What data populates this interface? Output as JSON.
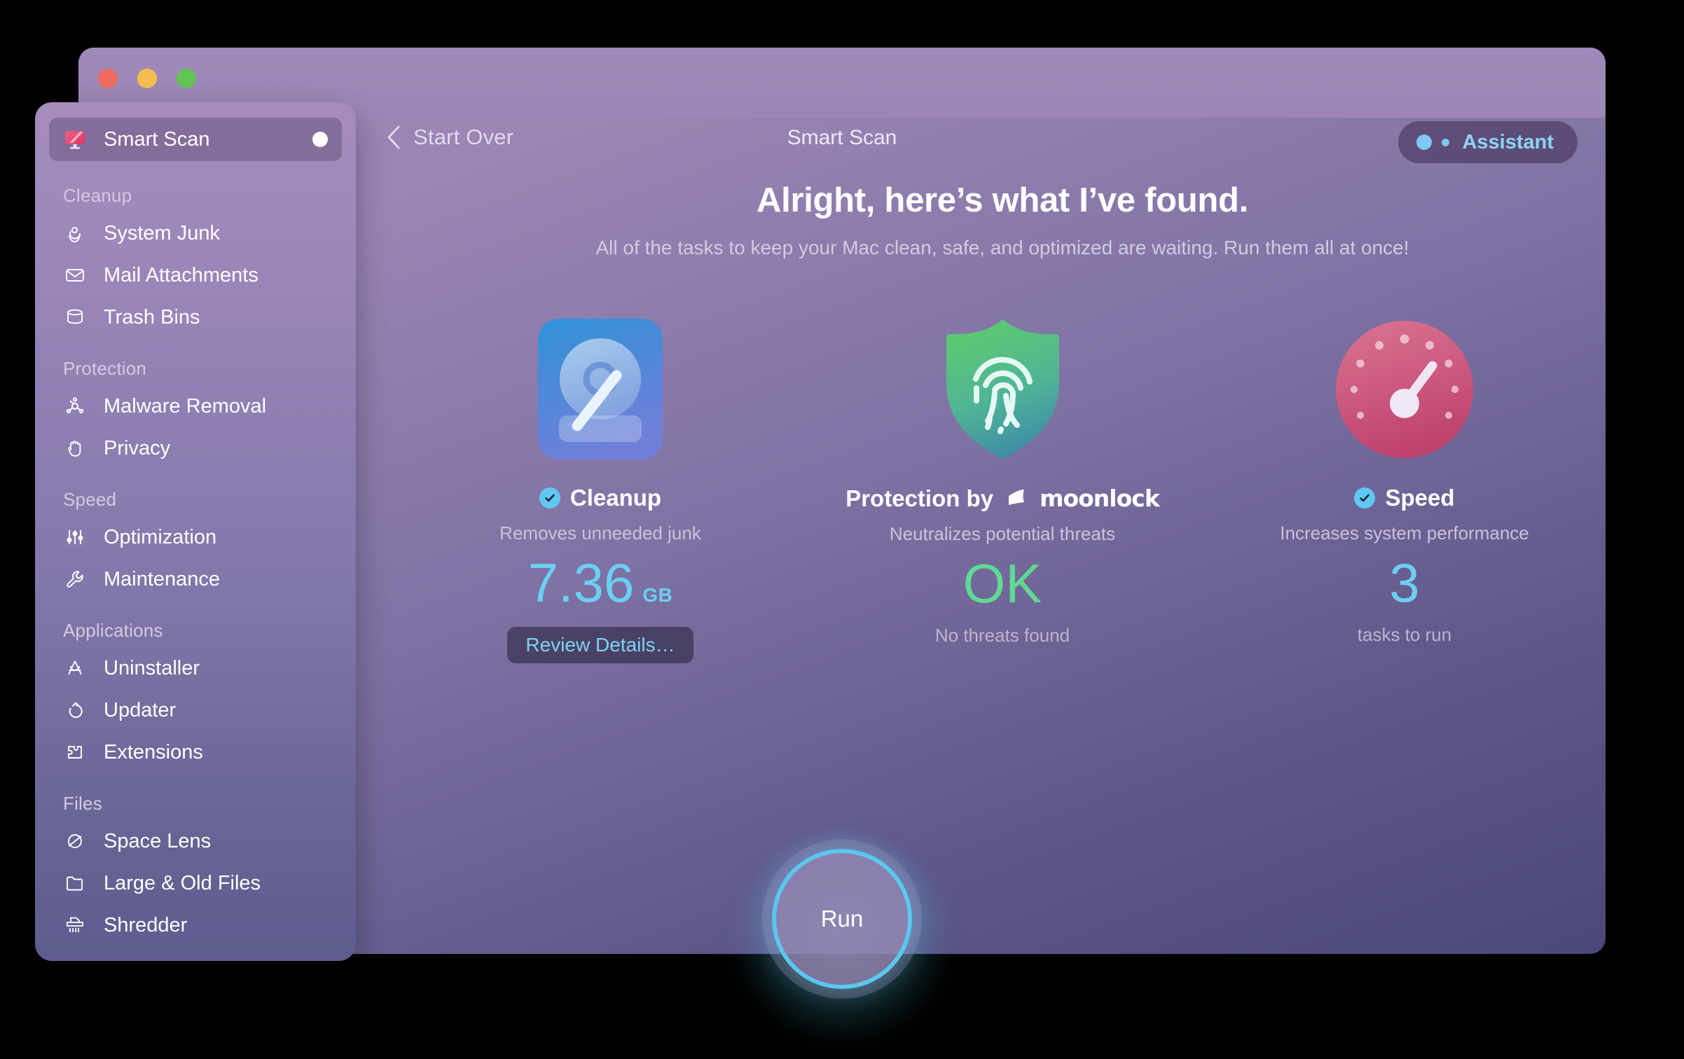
{
  "window": {
    "title": "Smart Scan",
    "traffic_lights": [
      "close",
      "minimize",
      "maximize"
    ],
    "back_label": "Start Over"
  },
  "assistant": {
    "label": "Assistant",
    "accent_color": "#8fd3f7"
  },
  "sidebar": {
    "active_item": "Smart Scan",
    "items": [
      {
        "label": "Smart Scan",
        "icon": "smart-scan-monitor-icon",
        "active": true,
        "trailing": "dot"
      }
    ],
    "groups": [
      {
        "title": "Cleanup",
        "items": [
          {
            "label": "System Junk",
            "icon": "broom-icon"
          },
          {
            "label": "Mail Attachments",
            "icon": "envelope-icon"
          },
          {
            "label": "Trash Bins",
            "icon": "trash-bin-icon"
          }
        ]
      },
      {
        "title": "Protection",
        "items": [
          {
            "label": "Malware Removal",
            "icon": "biohazard-icon"
          },
          {
            "label": "Privacy",
            "icon": "hand-icon"
          }
        ]
      },
      {
        "title": "Speed",
        "items": [
          {
            "label": "Optimization",
            "icon": "sliders-icon"
          },
          {
            "label": "Maintenance",
            "icon": "wrench-icon"
          }
        ]
      },
      {
        "title": "Applications",
        "items": [
          {
            "label": "Uninstaller",
            "icon": "app-store-icon"
          },
          {
            "label": "Updater",
            "icon": "refresh-arrow-icon"
          },
          {
            "label": "Extensions",
            "icon": "puzzle-piece-icon"
          }
        ]
      },
      {
        "title": "Files",
        "items": [
          {
            "label": "Space Lens",
            "icon": "planet-orbit-icon"
          },
          {
            "label": "Large & Old Files",
            "icon": "folder-icon"
          },
          {
            "label": "Shredder",
            "icon": "shredder-icon"
          }
        ]
      }
    ]
  },
  "main": {
    "headline": "Alright, here’s what I’ve found.",
    "subhead": "All of the tasks to keep your Mac clean, safe, and optimized are waiting. Run them all at once!",
    "cards": [
      {
        "id": "cleanup",
        "title": "Cleanup",
        "checked": true,
        "icon": "hard-drive-icon",
        "icon_color": "#4a8fd6",
        "subtitle": "Removes unneeded junk",
        "metric_value": "7.36",
        "metric_unit": "GB",
        "metric_color": "#6ccff2",
        "button_label": "Review Details…"
      },
      {
        "id": "protection",
        "title": "Protection by",
        "brand": "moonlock",
        "checked": false,
        "icon": "shield-fingerprint-icon",
        "icon_color": "#4fc07a",
        "subtitle": "Neutralizes potential threats",
        "metric_value": "OK",
        "metric_unit": "",
        "metric_color": "#5fd993",
        "note": "No threats found"
      },
      {
        "id": "speed",
        "title": "Speed",
        "checked": true,
        "icon": "speedometer-icon",
        "icon_color": "#c85a81",
        "subtitle": "Increases system performance",
        "metric_value": "3",
        "metric_unit": "",
        "metric_color": "#6ccff2",
        "note": "tasks to run"
      }
    ],
    "run_button_label": "Run"
  }
}
